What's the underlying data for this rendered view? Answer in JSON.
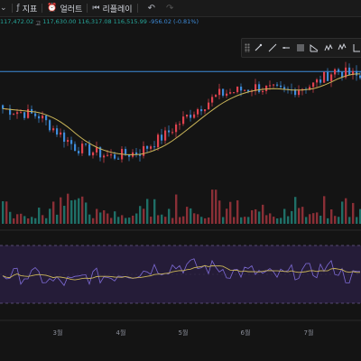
{
  "toolbar": {
    "indicators_label": "지표",
    "alerts_label": "얼러트",
    "replay_label": "리플레이"
  },
  "ohlc": {
    "open": "117,472.02",
    "high_label": "고",
    "high": "117,630.00",
    "low": "116,317.08",
    "close": "116,515.99",
    "change": "-956.02",
    "change_pct": "(-0.81%)"
  },
  "drawing_tools": [
    "pointer-icon",
    "trend-line-icon",
    "horizontal-ray-icon",
    "fib-retracement-icon",
    "brush-icon",
    "pattern-icon",
    "elliott-wave-icon",
    "measure-icon"
  ],
  "colors": {
    "up": "#e0424e",
    "down": "#3d8bd9",
    "ma": "#c9b458",
    "rsi": "#7e6bd6",
    "rsi_ma": "#c9b458",
    "hline": "#3d8bd9",
    "band": "#251c38"
  },
  "chart_data": {
    "type": "candlestick",
    "x_labels": [
      "3월",
      "4월",
      "5월",
      "6월",
      "7월"
    ],
    "ylim_price": [
      74000,
      123000
    ],
    "horizontal_line_price": 119500,
    "rsi_levels": [
      70,
      30
    ],
    "rsi_ylim": [
      10,
      90
    ]
  }
}
